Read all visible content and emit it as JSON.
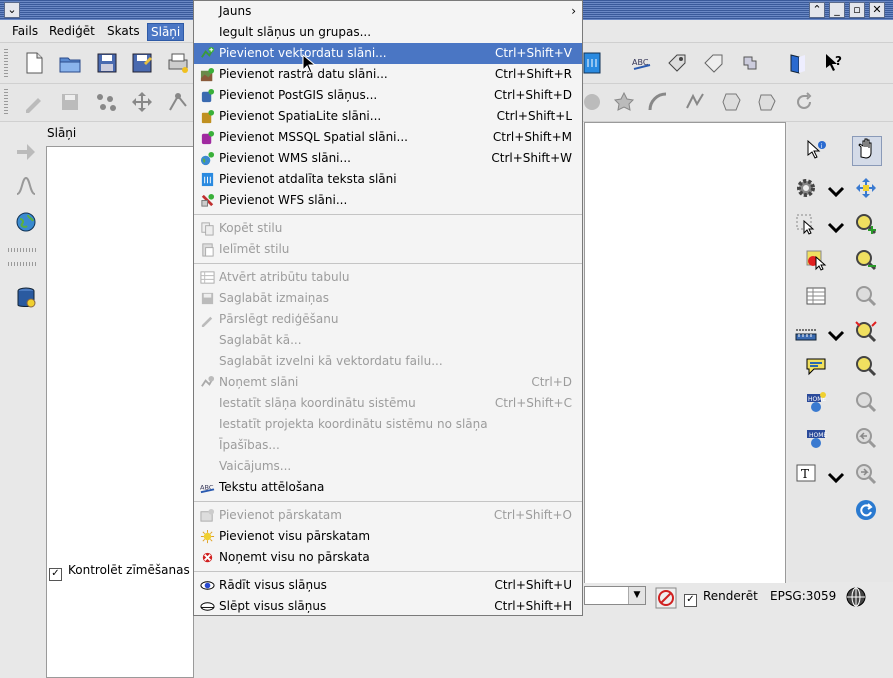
{
  "menubar": {
    "items": [
      {
        "label": "Fails"
      },
      {
        "label": "Rediģēt"
      },
      {
        "label": "Skats"
      },
      {
        "label": "Slāņi"
      }
    ]
  },
  "layers_panel": {
    "title": "Slāņi",
    "render_check": "Kontrolēt zīmēšanas",
    "render_checked": true
  },
  "statusbar": {
    "render_label": "Renderēt",
    "render_checked": true,
    "epsg": "EPSG:3059"
  },
  "dropdown": {
    "items": [
      {
        "label": "Jauns",
        "shortcut": "",
        "disabled": false,
        "submenu": true
      },
      {
        "label": "Iegult slāņus un grupas...",
        "shortcut": "",
        "disabled": false
      },
      {
        "label": "Pievienot vektordatu slāni...",
        "shortcut": "Ctrl+Shift+V",
        "disabled": false,
        "highlighted": true
      },
      {
        "label": "Pievienot rastra datu slāni...",
        "shortcut": "Ctrl+Shift+R",
        "disabled": false
      },
      {
        "label": "Pievienot PostGIS slāņus...",
        "shortcut": "Ctrl+Shift+D",
        "disabled": false
      },
      {
        "label": "Pievienot SpatiaLite slāni...",
        "shortcut": "Ctrl+Shift+L",
        "disabled": false
      },
      {
        "label": "Pievienot MSSQL Spatial slāni...",
        "shortcut": "Ctrl+Shift+M",
        "disabled": false
      },
      {
        "label": "Pievienot WMS slāni...",
        "shortcut": "Ctrl+Shift+W",
        "disabled": false
      },
      {
        "label": "Pievienot atdalīta teksta slāni",
        "shortcut": "",
        "disabled": false
      },
      {
        "label": "Pievienot WFS slāni...",
        "shortcut": "",
        "disabled": false
      },
      {
        "label": "Kopēt stilu",
        "shortcut": "",
        "disabled": true
      },
      {
        "label": "Ielīmēt stilu",
        "shortcut": "",
        "disabled": true
      },
      {
        "label": "Atvērt atribūtu tabulu",
        "shortcut": "",
        "disabled": true
      },
      {
        "label": "Saglabāt izmaiņas",
        "shortcut": "",
        "disabled": true
      },
      {
        "label": "Pārslēgt rediģēšanu",
        "shortcut": "",
        "disabled": true
      },
      {
        "label": "Saglabāt kā...",
        "shortcut": "",
        "disabled": true
      },
      {
        "label": "Saglabāt izvelni kā vektordatu failu...",
        "shortcut": "",
        "disabled": true
      },
      {
        "label": "Noņemt slāni",
        "shortcut": "Ctrl+D",
        "disabled": true
      },
      {
        "label": "Iestatīt slāņa koordinātu sistēmu",
        "shortcut": "Ctrl+Shift+C",
        "disabled": true
      },
      {
        "label": "Iestatīt projekta koordinātu sistēmu no slāņa",
        "shortcut": "",
        "disabled": true
      },
      {
        "label": "Īpašības...",
        "shortcut": "",
        "disabled": true
      },
      {
        "label": "Vaicājums...",
        "shortcut": "",
        "disabled": true
      },
      {
        "label": "Tekstu attēlošana",
        "shortcut": "",
        "disabled": false
      },
      {
        "label": "Pievienot pārskatam",
        "shortcut": "Ctrl+Shift+O",
        "disabled": true
      },
      {
        "label": "Pievienot visu pārskatam",
        "shortcut": "",
        "disabled": false
      },
      {
        "label": "Noņemt visu no pārskata",
        "shortcut": "",
        "disabled": false
      },
      {
        "label": "Rādīt visus slāņus",
        "shortcut": "Ctrl+Shift+U",
        "disabled": false
      },
      {
        "label": "Slēpt visus slāņus",
        "shortcut": "Ctrl+Shift+H",
        "disabled": false
      }
    ]
  },
  "colors": {
    "highlight": "#4a76c4",
    "titlebar": "#3a5a9a",
    "disabled_text": "#9c9c9c"
  }
}
